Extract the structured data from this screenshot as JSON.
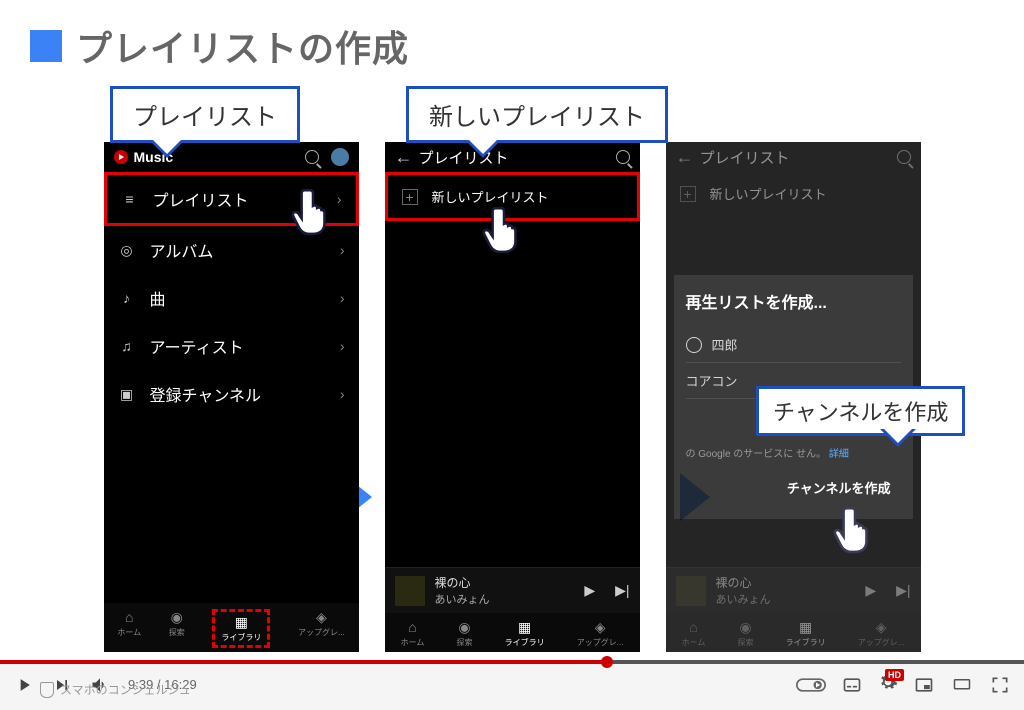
{
  "slide": {
    "title": "プレイリストの作成"
  },
  "callouts": {
    "c1": "プレイリスト",
    "c2": "新しいプレイリスト",
    "c3": "チャンネルを作成"
  },
  "phone1": {
    "brand": "Music",
    "menu": [
      "プレイリスト",
      "アルバム",
      "曲",
      "アーティスト",
      "登録チャンネル"
    ]
  },
  "phone2": {
    "header": "プレイリスト",
    "new_playlist": "新しいプレイリスト",
    "nowplaying": {
      "title": "裸の心",
      "artist": "あいみょん"
    }
  },
  "phone3": {
    "header": "プレイリスト",
    "new_playlist": "新しいプレイリスト",
    "dialog": {
      "title": "再生リストを作成...",
      "user": "四郎",
      "name": "コアコン",
      "sub_prefix": "の Google のサービスに",
      "sub_suffix": "せん。",
      "sub_link": "詳細",
      "button": "チャンネルを作成"
    },
    "nowplaying": {
      "title": "裸の心",
      "artist": "あいみょん"
    }
  },
  "navbar": {
    "items": [
      "ホーム",
      "探索",
      "ライブラリ",
      "アップグレ..."
    ]
  },
  "player": {
    "current": "9:39",
    "total": "16:29",
    "channel": "スマホのコンシェルジュ",
    "hd": "HD"
  }
}
